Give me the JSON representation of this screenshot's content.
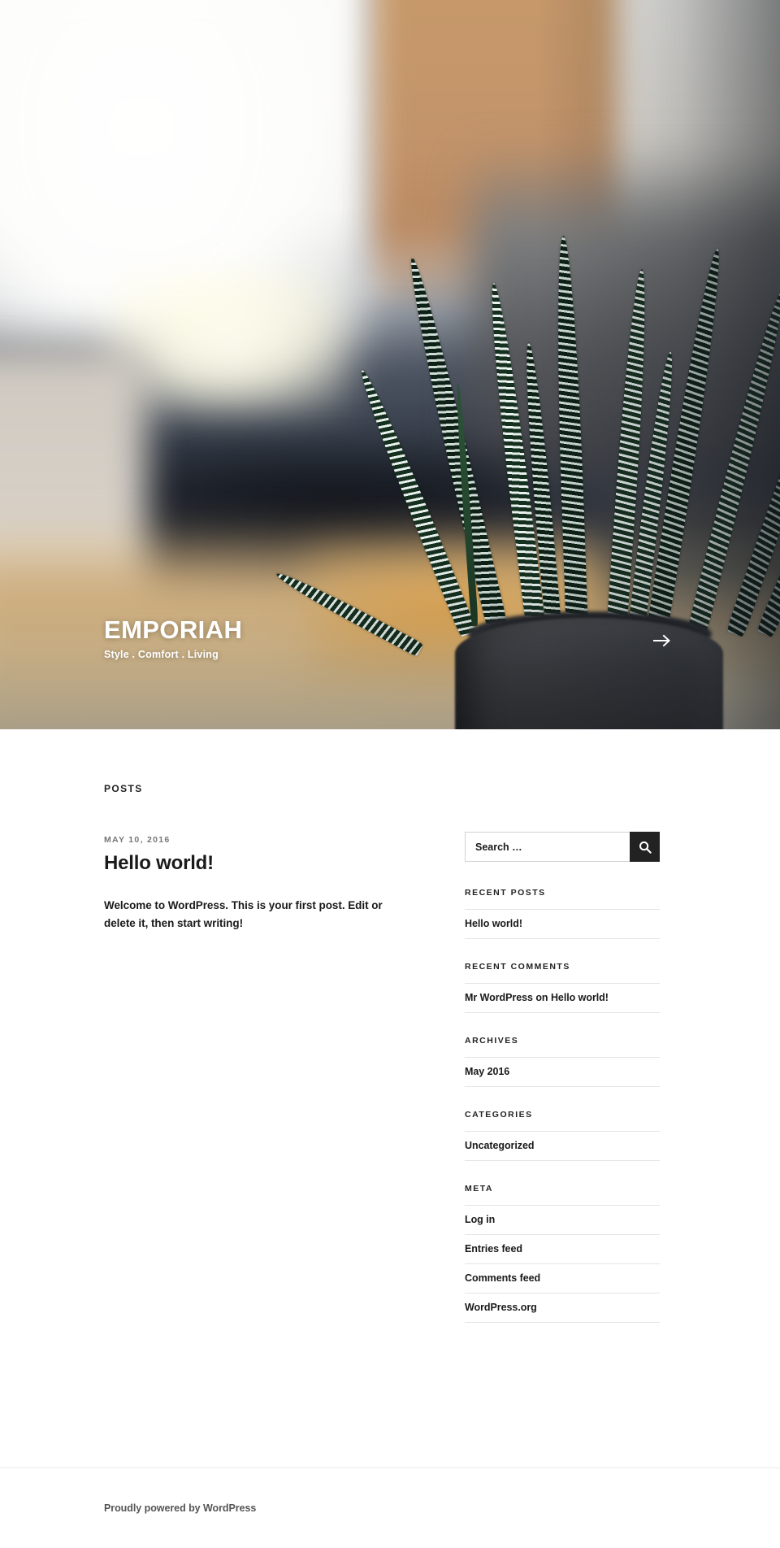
{
  "site": {
    "title": "EMPORIAH",
    "description": "Style . Comfort . Living",
    "scroll_arrow_icon": "arrow-right-icon"
  },
  "content": {
    "section_label": "POSTS",
    "post": {
      "date": "MAY 10, 2016",
      "title": "Hello world!",
      "excerpt": "Welcome to WordPress. This is your first post. Edit or delete it, then start writing!"
    }
  },
  "sidebar": {
    "search": {
      "placeholder": "Search …",
      "value": "",
      "button_icon": "search-icon"
    },
    "widgets": [
      {
        "title": "RECENT POSTS",
        "items": [
          "Hello world!"
        ]
      },
      {
        "title": "RECENT COMMENTS",
        "comments": [
          {
            "author": "Mr WordPress",
            "separator": " on ",
            "post": "Hello world!"
          }
        ]
      },
      {
        "title": "ARCHIVES",
        "items": [
          "May 2016"
        ]
      },
      {
        "title": "CATEGORIES",
        "items": [
          "Uncategorized"
        ]
      },
      {
        "title": "META",
        "items": [
          "Log in",
          "Entries feed",
          "Comments feed",
          "WordPress.org"
        ]
      }
    ]
  },
  "footer": {
    "credit": "Proudly powered by WordPress"
  },
  "colors": {
    "text": "#1a1a1a",
    "muted": "#767676",
    "accent": "#222222",
    "rule": "#e4e4e4",
    "footer_text": "#555555"
  }
}
